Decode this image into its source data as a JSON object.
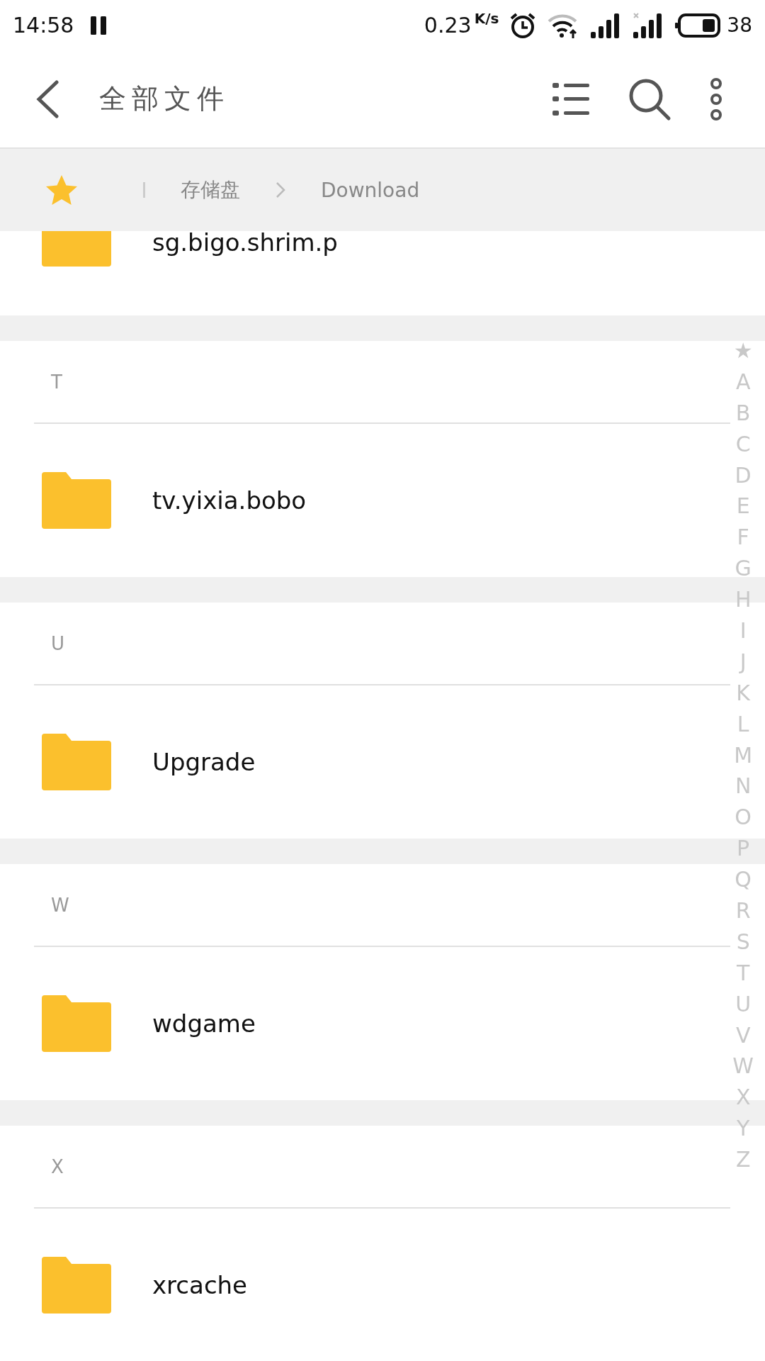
{
  "status_bar": {
    "time": "14:58",
    "speed": "0.23",
    "speed_unit": "K/s",
    "battery": "38"
  },
  "app_bar": {
    "title": "全部文件"
  },
  "breadcrumb": {
    "items": [
      "存储盘",
      "Download"
    ]
  },
  "partial_item": {
    "name": "sg.bigo.shrim.p"
  },
  "sections": [
    {
      "letter": "T",
      "items": [
        {
          "name": "tv.yixia.bobo"
        }
      ]
    },
    {
      "letter": "U",
      "items": [
        {
          "name": "Upgrade"
        }
      ]
    },
    {
      "letter": "W",
      "items": [
        {
          "name": "wdgame"
        }
      ]
    },
    {
      "letter": "X",
      "items": [
        {
          "name": "xrcache"
        }
      ]
    }
  ],
  "index_bar": [
    "★",
    "A",
    "B",
    "C",
    "D",
    "E",
    "F",
    "G",
    "H",
    "I",
    "J",
    "K",
    "L",
    "M",
    "N",
    "O",
    "P",
    "Q",
    "R",
    "S",
    "T",
    "U",
    "V",
    "W",
    "X",
    "Y",
    "Z"
  ]
}
